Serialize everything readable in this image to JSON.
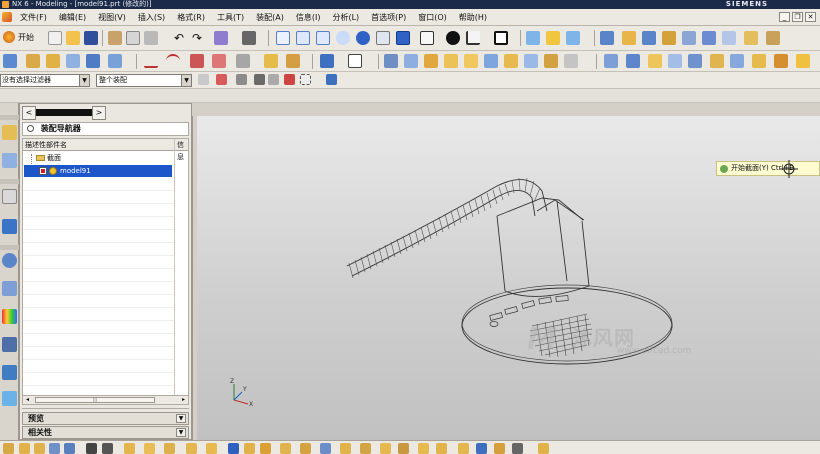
{
  "window": {
    "title": "NX 6 - Modeling - [model91.prt (修改的)]",
    "brand": "SIEMENS",
    "controls": [
      "_",
      "❐",
      "✕"
    ]
  },
  "menu": [
    {
      "label": "文件(F)"
    },
    {
      "label": "编辑(E)"
    },
    {
      "label": "视图(V)"
    },
    {
      "label": "插入(S)"
    },
    {
      "label": "格式(R)"
    },
    {
      "label": "工具(T)"
    },
    {
      "label": "装配(A)"
    },
    {
      "label": "信息(I)"
    },
    {
      "label": "分析(L)"
    },
    {
      "label": "首选项(P)"
    },
    {
      "label": "窗口(O)"
    },
    {
      "label": "帮助(H)"
    }
  ],
  "toolbar": {
    "start_label": "开始",
    "filter_value": "没有选择过滤器",
    "assembly_value": "整个装配"
  },
  "navigator": {
    "title": "装配导航器",
    "col_desc": "描述性部件名",
    "col_info": "信息",
    "rows": [
      {
        "label": "截面"
      },
      {
        "label": "model91"
      }
    ],
    "scroll_thumb": "|||",
    "panels": [
      {
        "label": "预览"
      },
      {
        "label": "相关性"
      }
    ]
  },
  "viewport": {
    "tooltip": "开始截面(Y)   Ctrl+B",
    "watermark": {
      "logo": "M",
      "cn": "沐风网",
      "url": "www.mfcad.com"
    },
    "axis_labels": {
      "x": "X",
      "y": "Y",
      "z": "Z"
    }
  },
  "colors": {
    "title_bar": "#1b2a48",
    "selection": "#1c56c8",
    "viewport_top": "#e9e9e9",
    "viewport_bottom": "#c1c1c1",
    "tooltip_bg": "#fffbd0"
  }
}
